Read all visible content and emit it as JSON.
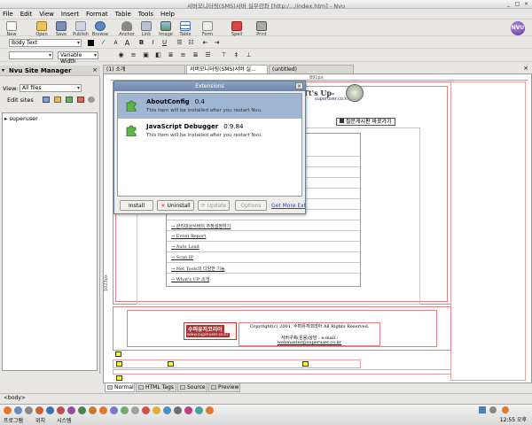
{
  "window": {
    "title": "서버모니터링(SMS)서버 실무강좌 [http:/.../index.htm] - Nvu",
    "controls": [
      "_",
      "□",
      "×"
    ]
  },
  "menu": [
    "File",
    "Edit",
    "View",
    "Insert",
    "Format",
    "Table",
    "Tools",
    "Help"
  ],
  "toolbar": [
    "New",
    "Open",
    "Save",
    "Publish",
    "Browse",
    "Anchor",
    "Link",
    "Image",
    "Table",
    "Form",
    "Spell",
    "Print"
  ],
  "logo_text": "NVU",
  "format_bar": {
    "paragraph_style": "Body Text",
    "font": "Variable Width"
  },
  "site_manager": {
    "title": "Nvu Site Manager",
    "view_label": "View:",
    "view_value": "All files",
    "edit_sites": "Edit sites",
    "tree_item": "superuser"
  },
  "tabs": [
    "(1) 소개",
    "서버모니터링(SMS)서버 실...",
    "(untitled)"
  ],
  "editor": {
    "ruler_label": "891px",
    "side_label": "1023px",
    "header_text": "Tt's Up-",
    "header_sub": "superuser.co.kr",
    "qa_button": "질문게시판 바로가기",
    "links": [
      "→ 관리대상서버의 추정설정하기",
      "→ Event Report",
      "→ Auto Load",
      "→ Scan IP",
      "→ Net Tools의 다양한 기능",
      "→ What's UP 소개"
    ],
    "footer_logo": "수퍼유저코리아",
    "footer_logo_sub": "www.superuser.co.kr",
    "footer_copy": "Copyright(c) 2001, 수퍼유저코리아 All Rights Reserved.",
    "footer_line2": "서버구축(운용)상담 : e-mail :",
    "footer_email": "webmaster@superuser.co.kr"
  },
  "dialog": {
    "title": "Extensions",
    "extensions": [
      {
        "name": "AboutConfig",
        "version": "0.4",
        "desc": "This item will be installed after you restart Nvu."
      },
      {
        "name": "JavaScript Debugger",
        "version": "0.9.84",
        "desc": "This item will be installed after you restart Nvu."
      }
    ],
    "buttons": {
      "install": "Install",
      "uninstall": "Uninstall",
      "update": "Update",
      "options": "Options",
      "get_more": "Get More Ext"
    }
  },
  "bottom_tabs": [
    "Normal",
    "HTML Tags",
    "Source",
    "Preview"
  ],
  "status": "<body>",
  "taskbar": {
    "labels": [
      "프로그램",
      "위치",
      "시스템"
    ],
    "clock": "12:55 오후"
  }
}
